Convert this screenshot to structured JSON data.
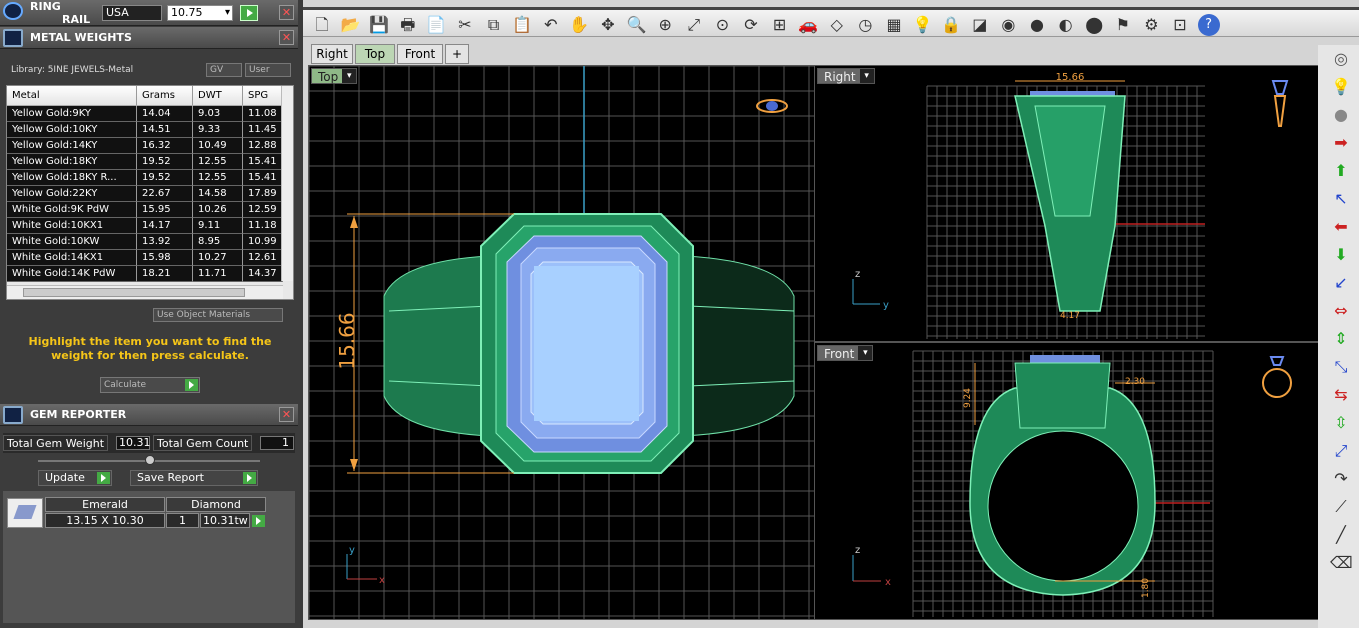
{
  "ringrail": {
    "title_line1": "RING",
    "title_line2": "RAIL",
    "country": "USA",
    "size": "10.75"
  },
  "metal": {
    "title": "METAL WEIGHTS",
    "library": "Library: 5INE JEWELS-Metal",
    "gv": "GV",
    "user": "User",
    "columns": [
      "Metal",
      "Grams",
      "DWT",
      "SPG"
    ],
    "rows": [
      [
        "Yellow Gold:9KY",
        "14.04",
        "9.03",
        "11.08"
      ],
      [
        "Yellow Gold:10KY",
        "14.51",
        "9.33",
        "11.45"
      ],
      [
        "Yellow Gold:14KY",
        "16.32",
        "10.49",
        "12.88"
      ],
      [
        "Yellow Gold:18KY",
        "19.52",
        "12.55",
        "15.41"
      ],
      [
        "Yellow Gold:18KY R...",
        "19.52",
        "12.55",
        "15.41"
      ],
      [
        "Yellow Gold:22KY",
        "22.67",
        "14.58",
        "17.89"
      ],
      [
        "White Gold:9K PdW",
        "15.95",
        "10.26",
        "12.59"
      ],
      [
        "White Gold:10KX1",
        "14.17",
        "9.11",
        "11.18"
      ],
      [
        "White Gold:10KW",
        "13.92",
        "8.95",
        "10.99"
      ],
      [
        "White Gold:14KX1",
        "15.98",
        "10.27",
        "12.61"
      ],
      [
        "White Gold:14K PdW",
        "18.21",
        "11.71",
        "14.37"
      ]
    ],
    "use_object": "Use Object Materials",
    "hint": "Highlight the item you want to find the weight for then press calculate.",
    "calculate": "Calculate"
  },
  "gem": {
    "title": "GEM REPORTER",
    "total_weight_label": "Total Gem Weight",
    "total_weight": "10.31",
    "total_count_label": "Total Gem Count",
    "total_count": "1",
    "update": "Update",
    "save_report": "Save Report",
    "col1": "Emerald",
    "col2": "Diamond",
    "size": "13.15 X 10.30",
    "count": "1",
    "tw": "10.31tw"
  },
  "tabs": [
    "Right",
    "Top",
    "Front",
    "+"
  ],
  "viewports": {
    "top": "Top",
    "right": "Right",
    "front": "Front"
  },
  "dims": {
    "top_height": "15.66",
    "right_width": "15.66",
    "right_bottom": "4.17",
    "front_h": "9.24",
    "front_w": "2.30",
    "front_b": "1.80"
  },
  "axes": {
    "z": "z",
    "y": "y",
    "x": "x"
  },
  "colors": {
    "metal": "#1f8a5a",
    "gem": "#8fb8f5",
    "dim": "#f0a040",
    "grid": "#555"
  }
}
